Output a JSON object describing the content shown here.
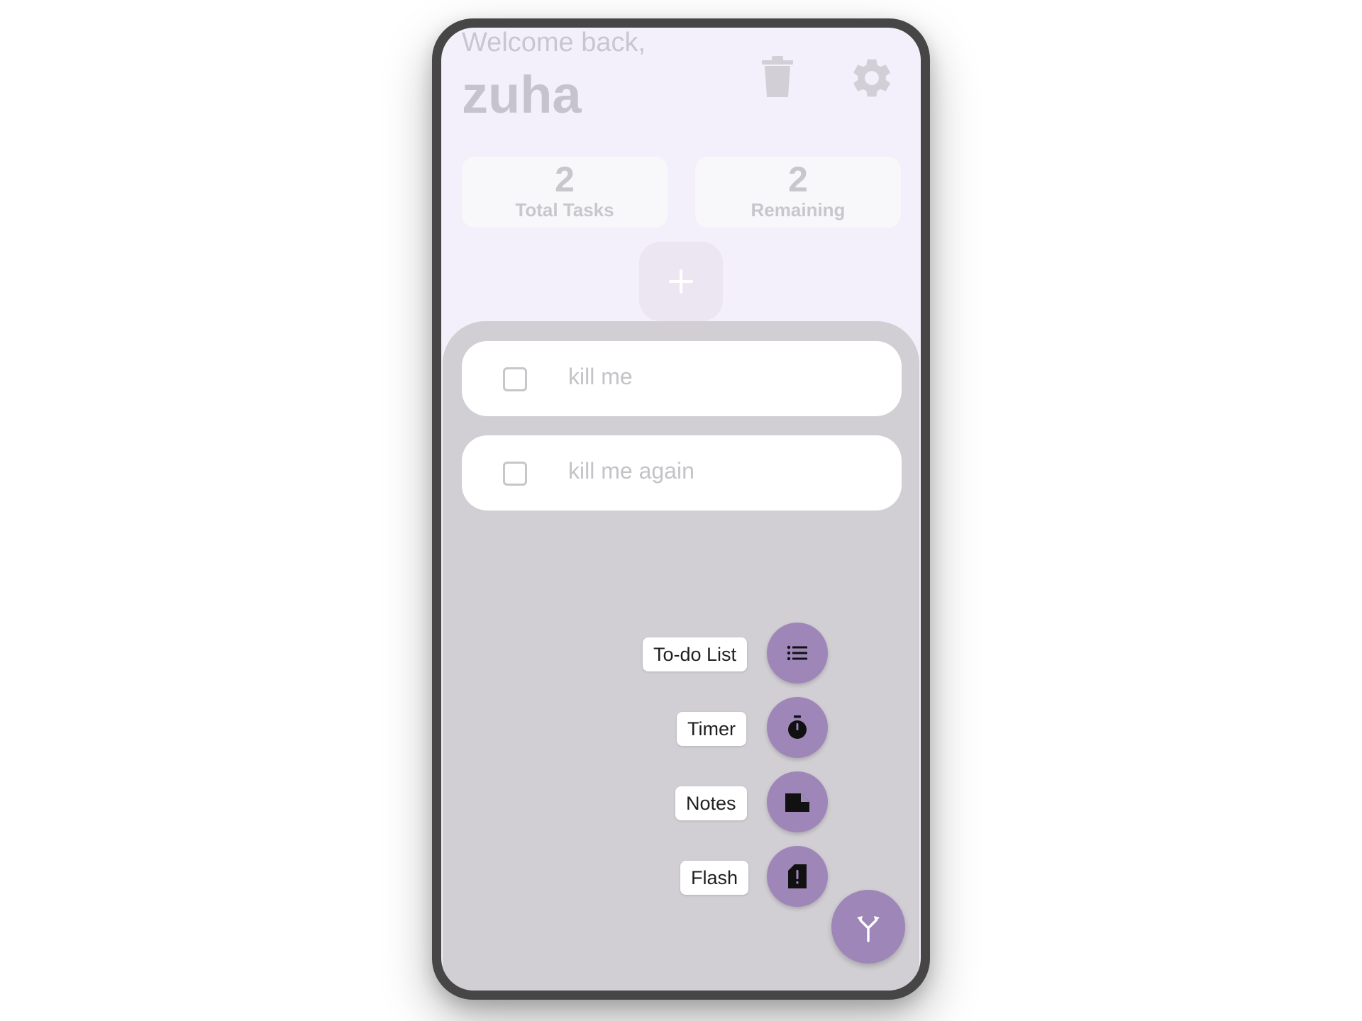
{
  "header": {
    "welcome": "Welcome back,",
    "username": "zuha"
  },
  "stats": {
    "total": {
      "value": "2",
      "label": "Total Tasks"
    },
    "remaining": {
      "value": "2",
      "label": "Remaining"
    }
  },
  "tasks": [
    {
      "text": "kill me",
      "checked": false
    },
    {
      "text": "kill me again",
      "checked": false
    }
  ],
  "speed_dial": {
    "items": [
      {
        "label": "To-do List",
        "icon": "list-icon"
      },
      {
        "label": "Timer",
        "icon": "timer-icon"
      },
      {
        "label": "Notes",
        "icon": "note-icon"
      },
      {
        "label": "Flash",
        "icon": "flashcard-icon"
      }
    ],
    "main_icon": "fork-arrows-icon"
  },
  "colors": {
    "accent": "#9e86b9",
    "screen_background": "#f4f0fb",
    "scrim_panel": "#d1cfd4"
  }
}
